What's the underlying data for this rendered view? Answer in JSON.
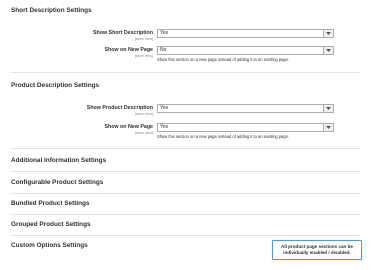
{
  "sections": {
    "short_description": {
      "title": "Short Description Settings",
      "show_short_description": {
        "label": "Show Short Description",
        "scope": "[store view]",
        "value": "Yes"
      },
      "show_on_new_page": {
        "label": "Show on New Page",
        "scope": "[store view]",
        "value": "No",
        "note": "Show this section on a new page instead of adding it to an existing page."
      }
    },
    "product_description": {
      "title": "Product Description Settings",
      "show_product_description": {
        "label": "Show Product Description",
        "scope": "[store view]",
        "value": "Yes"
      },
      "show_on_new_page": {
        "label": "Show on New Page",
        "scope": "[store view]",
        "value": "Yes",
        "note": "Show this section on a new page instead of adding it to an existing page."
      }
    },
    "collapsed": [
      "Additional Information Settings",
      "Configurable Product Settings",
      "Bundled Product Settings",
      "Grouped Product Settings",
      "Custom Options Settings"
    ]
  },
  "tooltip": {
    "line1": "All product page sections can be",
    "line2": "individually enabled / disabled."
  },
  "colors": {
    "tooltip_border": "#4b9be2",
    "select_border": "#adadad",
    "divider": "#e3e3e3"
  }
}
